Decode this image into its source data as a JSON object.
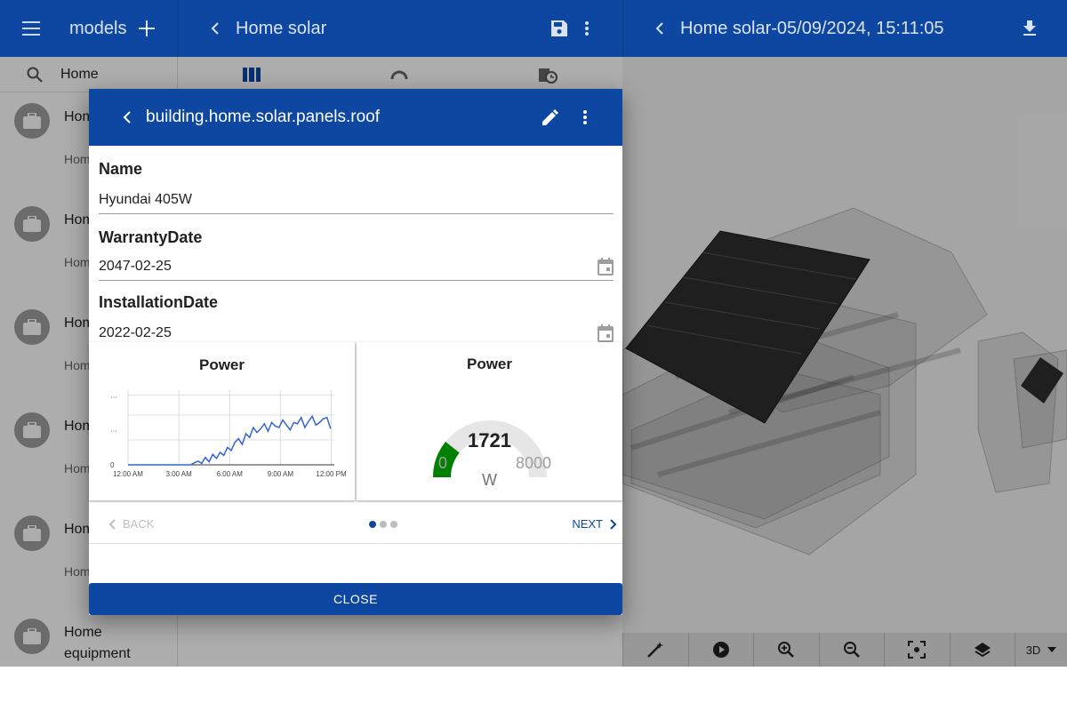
{
  "models_bar": {
    "title": "models"
  },
  "home_bar": {
    "title": "Home solar"
  },
  "view_bar": {
    "title": "Home solar-05/09/2024, 15:11:05"
  },
  "search": {
    "value": "Home"
  },
  "list": [
    {
      "title": "Home struc…",
      "subtitle": "Home struc…"
    },
    {
      "title": "Home space…",
      "subtitle": "Home space…"
    },
    {
      "title": "Home heat…",
      "subtitle": "Home heat…"
    },
    {
      "title": "Home gard…",
      "subtitle": "Home gard…"
    },
    {
      "title": "Home solar…",
      "subtitle": "Home solar…"
    },
    {
      "title": "Home equipment",
      "subtitle": ""
    }
  ],
  "dialog": {
    "title": "building.home.solar.panels.roof",
    "fields": [
      {
        "label": "Name",
        "value": "Hyundai 405W"
      },
      {
        "label": "WarrantyDate",
        "value": "2047-02-25"
      },
      {
        "label": "InstallationDate",
        "value": "2022-02-25"
      }
    ],
    "back_label": "BACK",
    "next_label": "NEXT",
    "close_label": "CLOSE"
  },
  "gauge": {
    "title": "Power",
    "value": "1721",
    "min": "0",
    "max": "8000",
    "unit": "W",
    "fraction": 0.215
  },
  "viewer": {
    "mode_label": "3D"
  },
  "colors": {
    "primary": "#0d47a1",
    "gauge": "#008000",
    "line": "#3366cc"
  },
  "chart_data": {
    "type": "line",
    "title": "Power",
    "x_ticks": [
      "12:00 AM",
      "3:00 AM",
      "6:00 AM",
      "9:00 AM",
      "12:00 PM"
    ],
    "y_ticks": [
      "0",
      "…",
      "…"
    ],
    "x_unit": "hours",
    "xlim": [
      0,
      14
    ],
    "ylim": [
      0,
      3000
    ],
    "grid": true,
    "series": [
      {
        "x": [
          0,
          0.5,
          1,
          1.5,
          2,
          2.5,
          3,
          3.5,
          4,
          4.25,
          4.5,
          4.75,
          5,
          5.25,
          5.5,
          5.75,
          6,
          6.25,
          6.5,
          6.75,
          7,
          7.25,
          7.5,
          7.75,
          8,
          8.25,
          8.5,
          8.75,
          9,
          9.25,
          9.5,
          9.75,
          10,
          10.25,
          10.5,
          10.75,
          11,
          11.25,
          11.5,
          11.75,
          12,
          12.25,
          12.5,
          12.75,
          13,
          13.25,
          13.5,
          13.75
        ],
        "values": [
          0,
          0,
          0,
          0,
          0,
          0,
          0,
          0,
          0,
          0,
          80,
          150,
          60,
          300,
          120,
          420,
          260,
          500,
          380,
          700,
          580,
          900,
          1050,
          820,
          1250,
          1100,
          1500,
          1300,
          1450,
          1650,
          1350,
          1700,
          1550,
          1500,
          1800,
          1600,
          1400,
          1700,
          1650,
          1900,
          1500,
          1750,
          1950,
          1600,
          1700,
          1850,
          1900,
          1450
        ]
      }
    ]
  }
}
